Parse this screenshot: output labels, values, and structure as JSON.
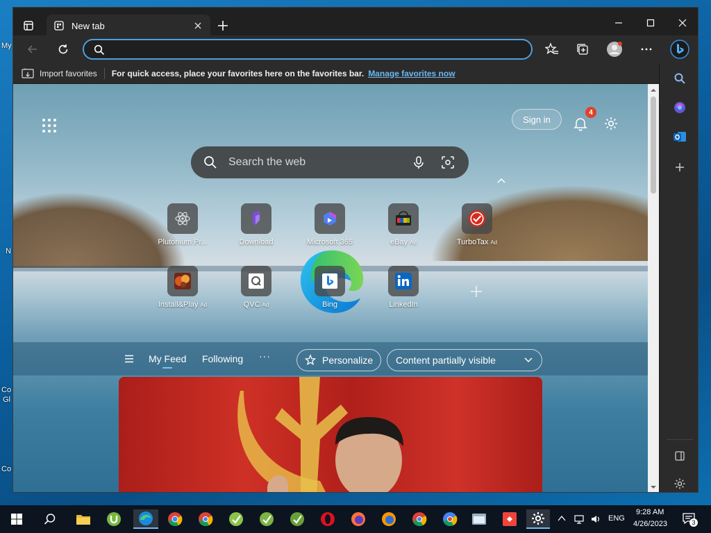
{
  "desktop": {
    "icons": [
      "My",
      "N",
      "Co",
      "Gl",
      "Co"
    ]
  },
  "browser": {
    "tab": {
      "title": "New tab"
    },
    "address": {
      "value": "",
      "placeholder": ""
    },
    "favorites_bar": {
      "import_label": "Import favorites",
      "message": "For quick access, place your favorites here on the favorites bar.",
      "manage_link": "Manage favorites now"
    }
  },
  "newtab": {
    "signin_label": "Sign in",
    "notifications_count": "4",
    "search_placeholder": "Search the web",
    "ad_label": "Ad",
    "tiles_row1": [
      {
        "label": "Plutonium Pr...",
        "ad": false
      },
      {
        "label": "Download",
        "ad": false
      },
      {
        "label": "Microsoft 365",
        "ad": false
      },
      {
        "label": "eBay",
        "ad": true
      },
      {
        "label": "TurboTax",
        "ad": true
      }
    ],
    "tiles_row2": [
      {
        "label": "Install&Play",
        "ad": true
      },
      {
        "label": "QVC",
        "ad": true
      },
      {
        "label": "Bing",
        "ad": false
      },
      {
        "label": "LinkedIn",
        "ad": false
      }
    ],
    "feed": {
      "tabs": [
        "My Feed",
        "Following"
      ],
      "active_tab": "My Feed",
      "more_label": "···",
      "personalize_label": "Personalize",
      "visibility_select": "Content partially visible"
    }
  },
  "taskbar": {
    "tray": {
      "language": "ENG",
      "time": "9:28 AM",
      "date": "4/26/2023",
      "notification_count": "3"
    }
  },
  "colors": {
    "accent": "#4ca0e0",
    "badge": "#e0412a",
    "link": "#6cb8f2",
    "taskbar": "#0c1420"
  }
}
